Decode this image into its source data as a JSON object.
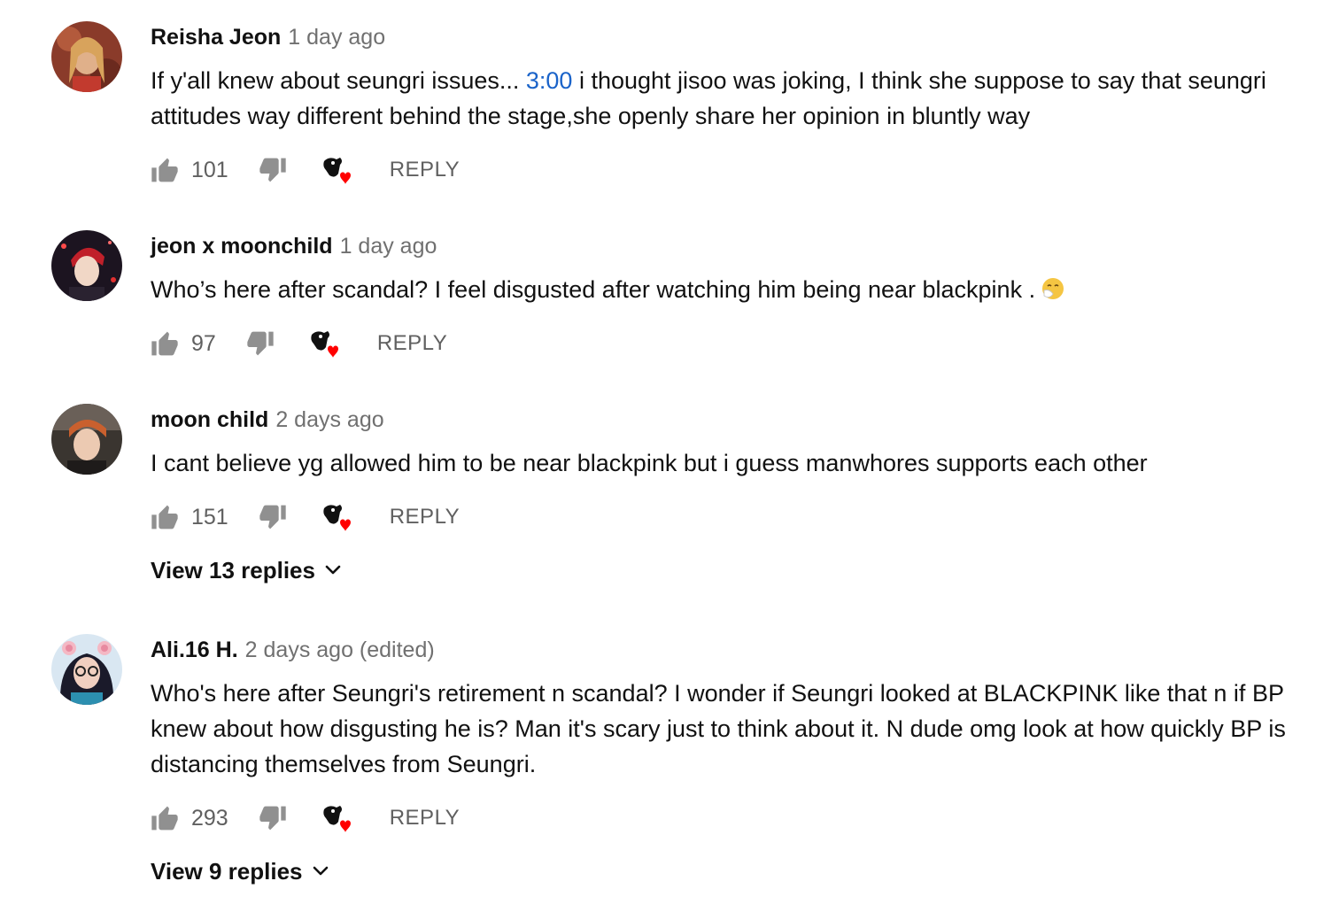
{
  "comments": [
    {
      "author": "Reisha Jeon",
      "time": "1 day ago",
      "text_before": "If y'all knew about seungri issues... ",
      "timestamp_link": "3:00",
      "text_after": " i thought jisoo was joking, I think she suppose to say that seungri attitudes way different behind the stage,she openly share her opinion in bluntly way",
      "likes": "101",
      "reply_label": "REPLY"
    },
    {
      "author": "jeon x moonchild",
      "time": "1 day ago",
      "text": "Who’s here after scandal? I feel disgusted after watching him being near blackpink .",
      "likes": "97",
      "reply_label": "REPLY"
    },
    {
      "author": "moon child",
      "time": "2 days ago",
      "text": "I cant believe yg allowed him to be near blackpink but i guess manwhores supports each other",
      "likes": "151",
      "reply_label": "REPLY",
      "view_replies": "View 13 replies"
    },
    {
      "author": "Ali.16 H.",
      "time": "2 days ago (edited)",
      "text": "Who's here after Seungri's retirement n scandal? I wonder if Seungri looked at BLACKPINK like that n if BP knew about how disgusting he is? Man it's scary just to think about it. N dude omg look at how quickly BP is distancing themselves from Seungri.",
      "likes": "293",
      "reply_label": "REPLY",
      "view_replies": "View 9 replies"
    }
  ],
  "icons": {
    "like": "thumbs-up-icon",
    "dislike": "thumbs-down-icon",
    "creator_heart": "creator-heart-icon",
    "expand": "chevron-down-icon",
    "emoji": "sneezing-face-emoji"
  },
  "colors": {
    "link": "#1a63c9",
    "heart": "#ff0000",
    "meta": "#707070"
  }
}
